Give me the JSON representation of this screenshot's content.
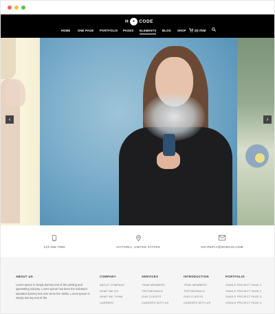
{
  "header": {
    "logo": {
      "left": "H",
      "mark": "●",
      "right": "CODE"
    },
    "nav": [
      "HOME",
      "ONE PAGE",
      "PORTFOLIO",
      "PAGES",
      "ELEMENTS",
      "BLOG",
      "SHOP"
    ],
    "active_nav": "ELEMENTS",
    "cart_label": "(0) ITEM"
  },
  "slider": {
    "prev_label": "‹",
    "next_label": "›"
  },
  "contact": {
    "phone": "123-456-7890",
    "location": "VICTORIA, UNITED STATES",
    "email": "NO-REPLY@DOMAIN.COM"
  },
  "footer": {
    "about": {
      "heading": "ABOUT US",
      "text": "Lorem Ipsum is simply dummy text of the printing and typesetting industry. Lorem Ipsum has been the industry's standard dummy text ever since the 1500s. Lorem Ipsum is simply dummy text of the"
    },
    "columns": [
      {
        "heading": "COMPANY",
        "links": [
          "ABOUT COMPANY",
          "WHAT WE DO",
          "WHAT WE THINK",
          "CAREERS"
        ]
      },
      {
        "heading": "SERVICES",
        "links": [
          "TEAM MEMBERS",
          "TESTIMONIALS",
          "OUR CLIENTS",
          "CAREERS WITH US"
        ]
      },
      {
        "heading": "INTRODUCTION",
        "links": [
          "TEAM MEMBERS",
          "TESTIMONIALS",
          "OUR CLIENTS",
          "CAREERS WITH US"
        ]
      },
      {
        "heading": "PORTFOLIO",
        "links": [
          "SINGLE PROJECT PAGE 1",
          "SINGLE PROJECT PAGE 2",
          "SINGLE PROJECT PAGE 3",
          "SINGLE PROJECT PAGE 4"
        ]
      }
    ]
  },
  "icons": {
    "phone": "phone-icon",
    "location": "map-pin-icon",
    "email": "envelope-icon",
    "cart": "cart-icon",
    "search": "search-icon"
  },
  "colors": {
    "header_bg": "#000000",
    "footer_bg": "#f5f5f5"
  }
}
